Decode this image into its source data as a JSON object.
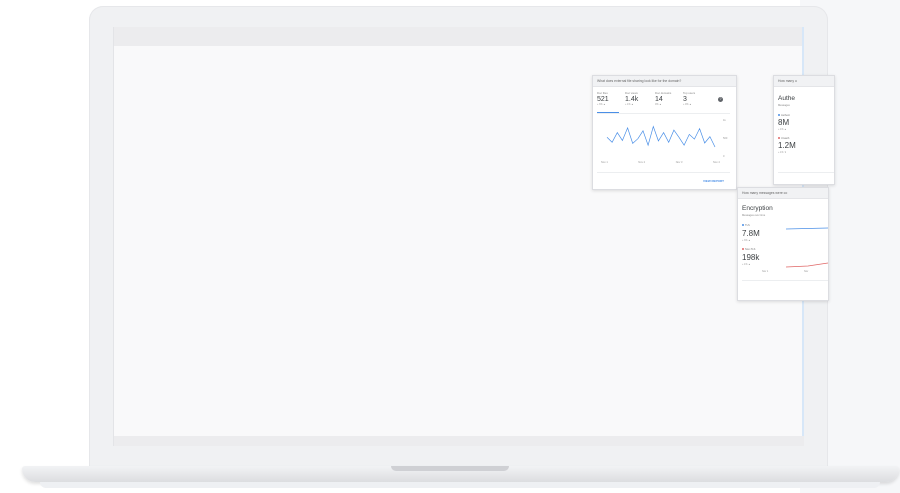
{
  "colors": {
    "accent": "#4a8fe7",
    "line_blue": "#4a8fe7",
    "line_red": "#e06666"
  },
  "card_a": {
    "question": "What does external file sharing look like for the domain?",
    "metrics": [
      {
        "label": "Doc files",
        "value": "521",
        "sub": "+ 3% ▲"
      },
      {
        "label": "Doc views",
        "value": "1.4k",
        "sub": "+ 1% ▲"
      },
      {
        "label": "Doc domains",
        "value": "14",
        "sub": "0% ▲"
      },
      {
        "label": "Top users",
        "value": "3",
        "sub": "+ 0% ▲"
      }
    ],
    "help_icon": "help-icon",
    "chart_data": {
      "type": "line",
      "x_ticks": [
        "Nov 1",
        "Nov 2",
        "Nov 3",
        "Nov 4"
      ],
      "y_ticks": [
        "1k",
        "500",
        "0"
      ],
      "series": [
        {
          "values": [
            520,
            380,
            650,
            430,
            780,
            350,
            480,
            700,
            300,
            820,
            420,
            650,
            380,
            720,
            520,
            300,
            600,
            470,
            760,
            360,
            540,
            250
          ]
        }
      ]
    },
    "view_report": "VIEW REPORT"
  },
  "card_b": {
    "question": "How many u",
    "title": "Authe",
    "subtitle": "Messages",
    "row1": {
      "label": "Authent",
      "value": "8M",
      "delta": "+ 1% ▲"
    },
    "row2": {
      "label": "Unauth",
      "value": "1.2M",
      "delta": "+ 1% ▼"
    }
  },
  "card_c": {
    "question": "How many messages were co",
    "title": "Encryption",
    "subtitle": "Messages over time",
    "row1": {
      "label": "TLS",
      "value": "7.8M",
      "delta": "+ 3% ▲"
    },
    "row2": {
      "label": "Non-TLS",
      "value": "198k",
      "delta": "+ 1% ▲"
    },
    "x_ticks": [
      "Nov 1",
      "Nov"
    ]
  }
}
